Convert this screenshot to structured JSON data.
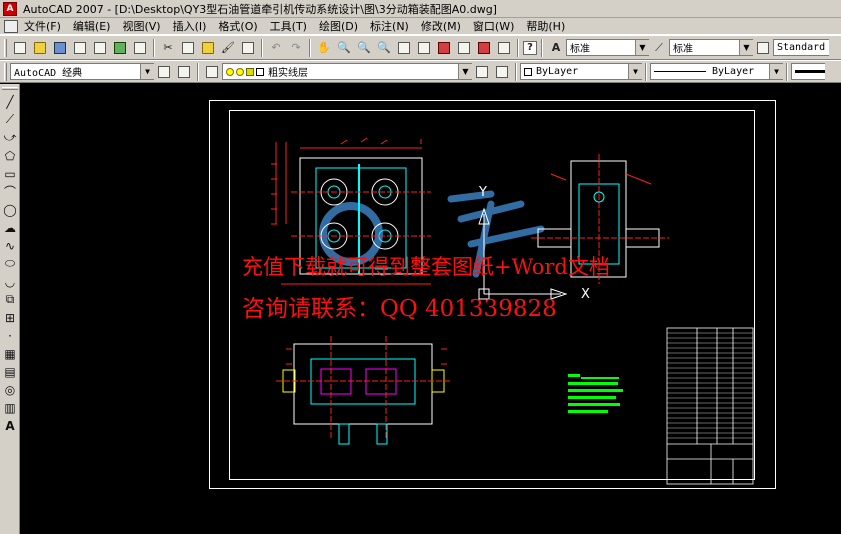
{
  "window": {
    "title": "AutoCAD 2007 - [D:\\Desktop\\QY3型石油管道牵引机传动系统设计\\图\\3分动箱装配图A0.dwg]"
  },
  "menu": [
    "文件(F)",
    "编辑(E)",
    "视图(V)",
    "插入(I)",
    "格式(O)",
    "工具(T)",
    "绘图(D)",
    "标注(N)",
    "修改(M)",
    "窗口(W)",
    "帮助(H)"
  ],
  "toolbar": {
    "text_style": "标准",
    "dim_style": "标准",
    "table_style": "Standard",
    "workspace": "AutoCAD 经典",
    "layer": "粗实线层",
    "color": "ByLayer",
    "linetype": "ByLayer"
  },
  "drawing": {
    "ucs_y": "Y",
    "ucs_x": "X"
  },
  "watermark": {
    "line1": "充值下载就可得到整套图纸+Word文档",
    "line2": "咨询请联系：QQ 401339828"
  },
  "colors": {
    "red": "#ff2020",
    "cyan": "#00ffff",
    "green": "#00ff00",
    "white": "#ffffff",
    "yellow": "#ffff00",
    "magenta": "#ff00ff",
    "blue_watermark": "#3a7fc0"
  }
}
